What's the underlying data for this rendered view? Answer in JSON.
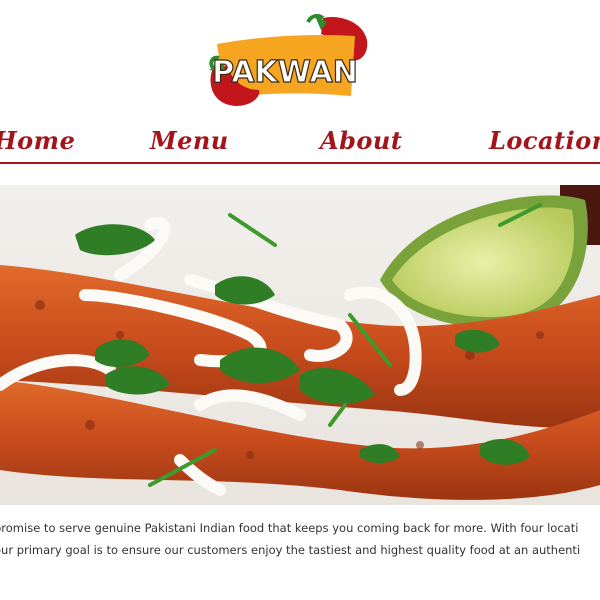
{
  "brand": {
    "logo_text": "PAKWAN",
    "colors": {
      "accent": "#a3141b",
      "logo_banner": "#f5a51f",
      "pepper": "#c2161c",
      "stem": "#2e8b2e"
    }
  },
  "nav": {
    "items": [
      {
        "label": "Home"
      },
      {
        "label": "Menu"
      },
      {
        "label": "About"
      },
      {
        "label": "Locations"
      }
    ]
  },
  "hero": {
    "image_subject": "seekh kebab with onion rings, cilantro and lime"
  },
  "intro": {
    "line1": "promise to serve genuine Pakistani Indian food that keeps you coming back for more. With four locati",
    "line2": "our primary goal is to ensure our customers enjoy the tastiest and highest quality food at an authenti"
  }
}
